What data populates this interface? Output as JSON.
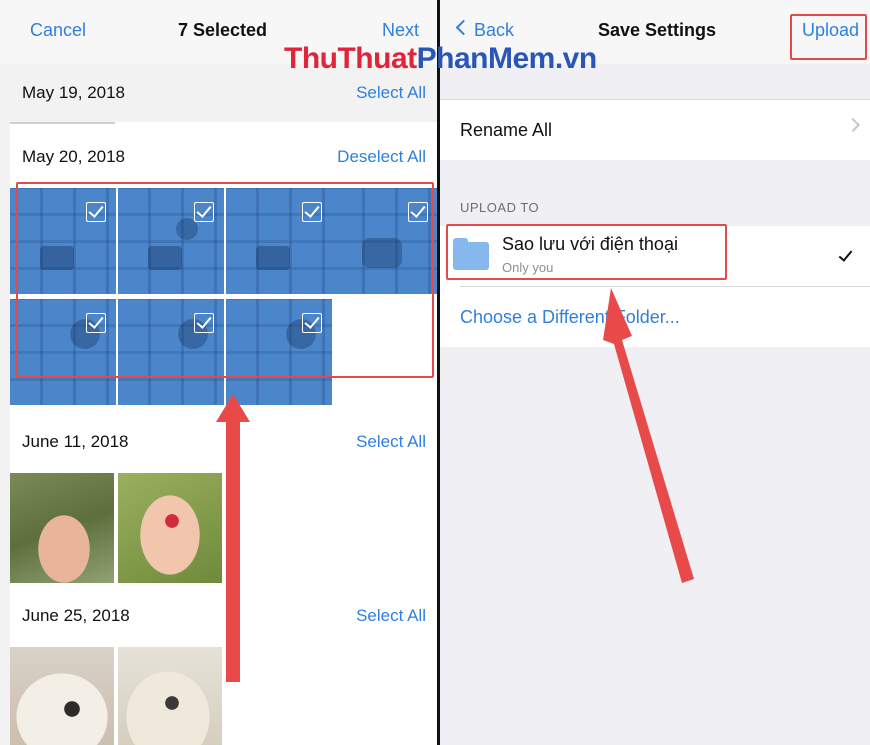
{
  "left_panel": {
    "nav": {
      "cancel": "Cancel",
      "title": "7 Selected",
      "next": "Next"
    },
    "sections": [
      {
        "date": "May 19, 2018",
        "action": "Select All"
      },
      {
        "date": "May 20, 2018",
        "action": "Deselect All"
      },
      {
        "date": "June 11, 2018",
        "action": "Select All"
      },
      {
        "date": "June 25, 2018",
        "action": "Select All"
      }
    ],
    "selected_count": 7
  },
  "right_panel": {
    "nav": {
      "back": "Back",
      "back_icon": "chevron-left-icon",
      "title": "Save Settings",
      "upload": "Upload"
    },
    "rename_all": "Rename All",
    "upload_to_header": "UPLOAD TO",
    "folder": {
      "name": "Sao lưu với điện thoại",
      "subtitle": "Only you",
      "icon": "folder-icon",
      "checked": true
    },
    "choose_folder": "Choose a Different Folder..."
  },
  "watermark": {
    "part1": "ThuThuat",
    "part2": "PhanMem",
    "part3": ".vn"
  },
  "colors": {
    "accent": "#2f7fe0",
    "annotation_red": "#e34b4b",
    "selected_tile": "#4a86c9"
  }
}
